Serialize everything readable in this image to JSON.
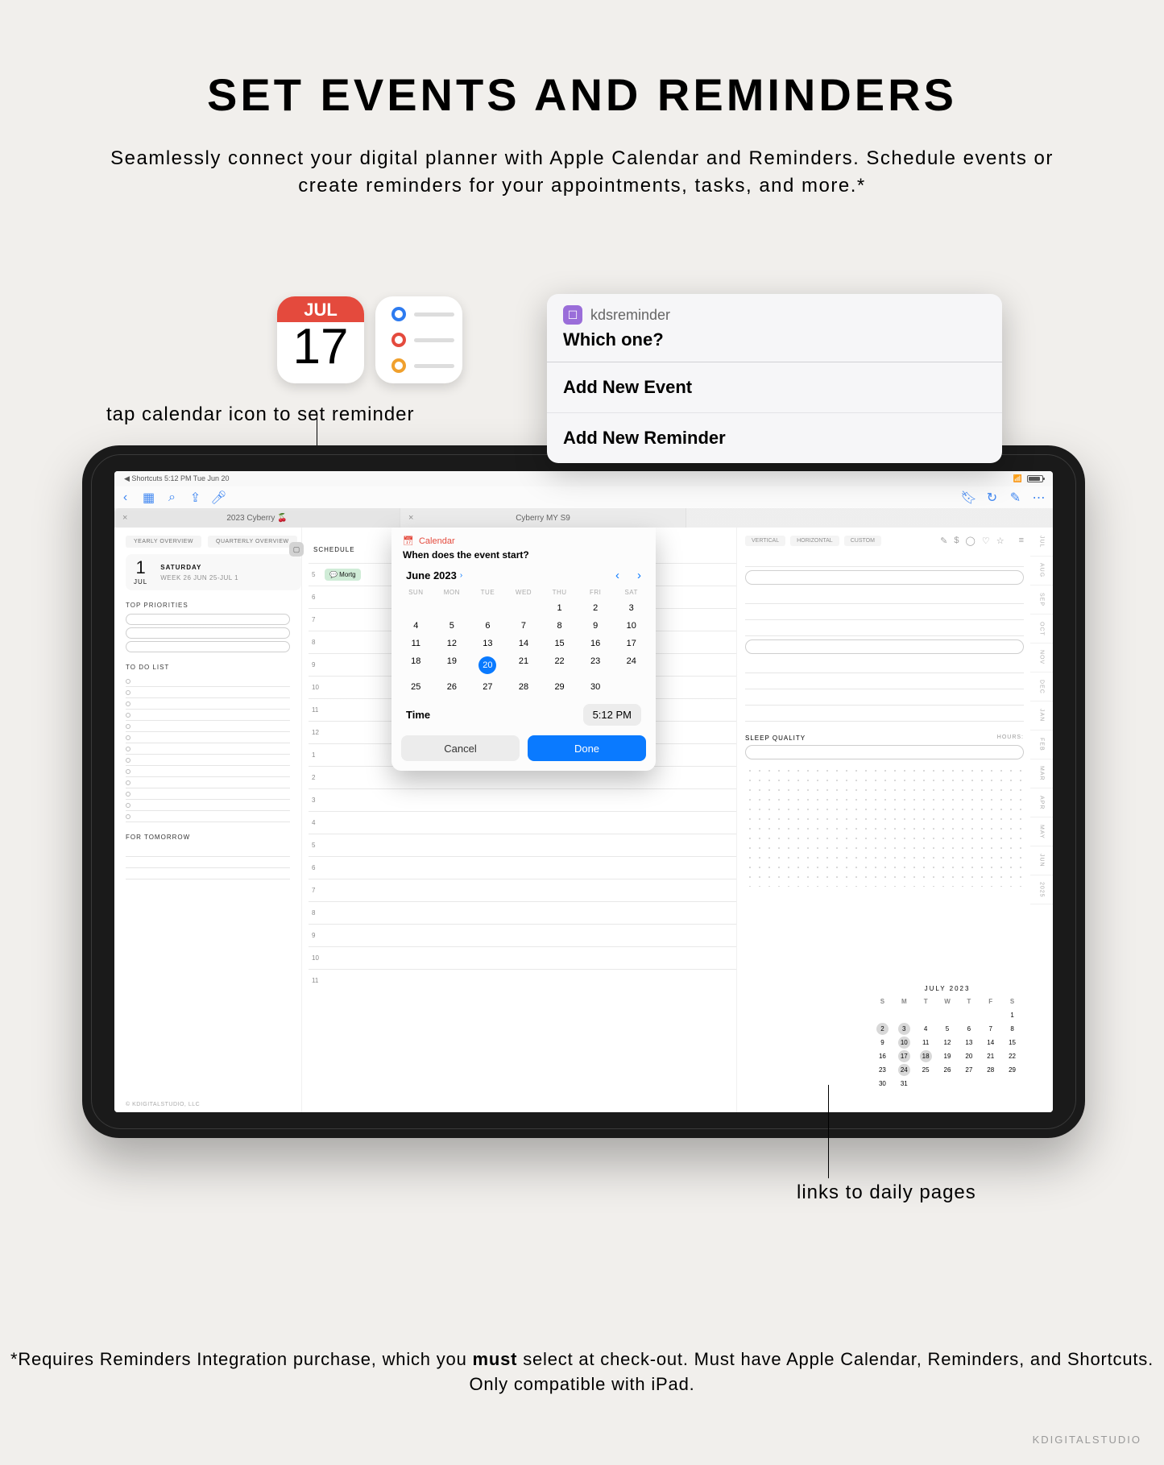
{
  "hero": {
    "title": "SET EVENTS AND REMINDERS",
    "subtitle": "Seamlessly connect your digital planner with Apple Calendar and Reminders. Schedule events or create reminders for your appointments, tasks, and more.*"
  },
  "callouts": {
    "tap_calendar": "tap calendar icon to set reminder",
    "links_daily": "links to daily pages"
  },
  "app_icons": {
    "calendar_month": "JUL",
    "calendar_day": "17"
  },
  "reminder_menu": {
    "app": "kdsreminder",
    "question": "Which one?",
    "items": [
      "Add New Event",
      "Add  New Reminder"
    ]
  },
  "status_bar": {
    "left": "◀ Shortcuts   5:12 PM   Tue Jun 20",
    "battery_pct": "80"
  },
  "toolbar": {
    "tabs": [
      "2023 Cyberry 🍒",
      "Cyberry MY S9"
    ]
  },
  "planner": {
    "overview_tabs": [
      "YEARLY OVERVIEW",
      "QUARTERLY OVERVIEW"
    ],
    "big_day": "1",
    "big_month": "JUL",
    "day_name": "SATURDAY",
    "week_line": "WEEK 26  JUN 25-JUL 1",
    "sections": {
      "priorities": "TOP PRIORITIES",
      "todo": "TO DO LIST",
      "tomorrow": "FOR TOMORROW",
      "schedule": "SCHEDULE",
      "sleep": "SLEEP QUALITY",
      "hours": "HOURS:"
    },
    "schedule_hours": [
      "5",
      "6",
      "7",
      "8",
      "9",
      "10",
      "11",
      "12",
      "1",
      "2",
      "3",
      "4",
      "5",
      "6",
      "7",
      "8",
      "9",
      "10",
      "11"
    ],
    "event_label": "Mortg",
    "right_tabs": [
      "VERTICAL",
      "HORIZONTAL",
      "CUSTOM"
    ],
    "side_tabs": [
      "JUL",
      "AUG",
      "SEP",
      "OCT",
      "NOV",
      "DEC",
      "JAN",
      "FEB",
      "MAR",
      "APR",
      "MAY",
      "JUN",
      "2025"
    ],
    "copyright": "© KDIGITALSTUDIO, LLC"
  },
  "mini_cal": {
    "title": "JULY 2023",
    "dow": [
      "S",
      "M",
      "T",
      "W",
      "T",
      "F",
      "S"
    ],
    "leading_blanks": 6,
    "days": 31,
    "circled": [
      2,
      3,
      10,
      17,
      18,
      24
    ]
  },
  "picker": {
    "app_label": "Calendar",
    "question": "When does the event start?",
    "month": "June 2023",
    "dow": [
      "SUN",
      "MON",
      "TUE",
      "WED",
      "THU",
      "FRI",
      "SAT"
    ],
    "leading_blanks": 4,
    "days": 30,
    "selected": 20,
    "time_label": "Time",
    "time_value": "5:12 PM",
    "cancel": "Cancel",
    "done": "Done"
  },
  "footer": {
    "note_prefix": "*Requires Reminders Integration purchase, which you ",
    "note_bold": "must",
    "note_suffix": " select at check-out. Must have Apple Calendar, Reminders, and Shortcuts. Only compatible with iPad."
  },
  "watermark": "KDIGITALSTUDIO"
}
